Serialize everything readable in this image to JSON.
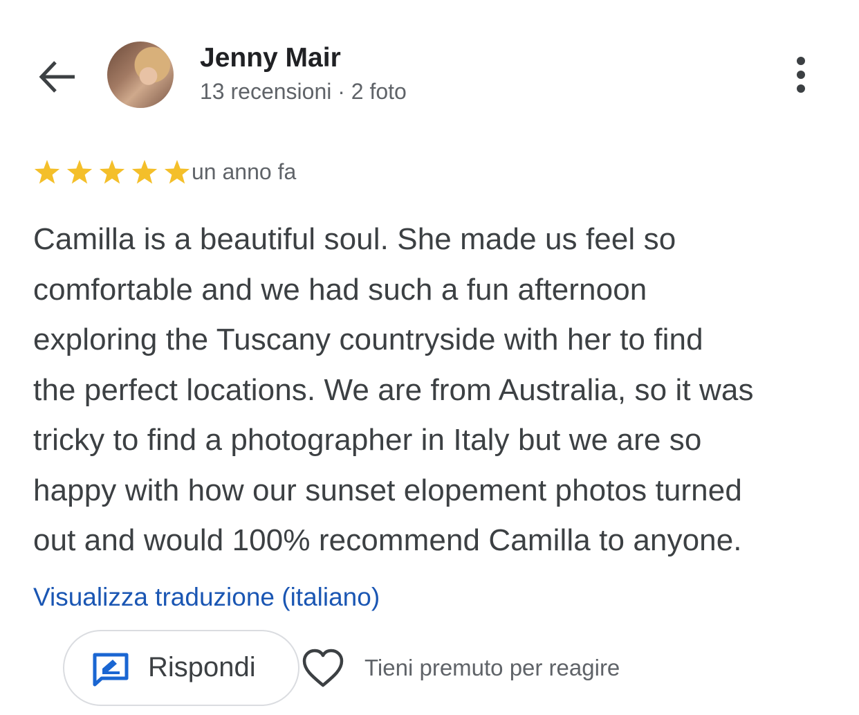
{
  "header": {
    "reviewer_name": "Jenny Mair",
    "reviewer_meta": "13 recensioni · 2 foto",
    "back_icon": "arrow-left-icon",
    "more_icon": "more-vertical-icon"
  },
  "review": {
    "rating": 5,
    "max_rating": 5,
    "star_color": "#f4bf2a",
    "time_ago": "un anno fa",
    "text": "Camilla is a beautiful soul. She made us feel so comfortable and we had such a fun afternoon exploring the Tuscany countryside with her to find the perfect locations. We are from Australia, so it was tricky to find a photographer in Italy but we are so happy with how our sunset elopement photos turned out and would 100% recommend Camilla to anyone.",
    "text_lines": [
      "Camilla is a beautiful soul. She made us feel so",
      "comfortable and we had such a fun afternoon",
      "exploring the Tuscany countryside with her to find",
      "the perfect locations. We are from Australia, so it was",
      "tricky to find a photographer in Italy but we are so",
      "happy with how our sunset elopement photos turned",
      "out and would 100% recommend Camilla to anyone."
    ],
    "translate_link": "Visualizza traduzione (italiano)",
    "link_color": "#1a56b3"
  },
  "actions": {
    "reply_label": "Rispondi",
    "reply_icon": "reply-edit-icon",
    "reply_icon_color": "#1a66d2",
    "heart_icon": "heart-outline-icon",
    "react_hint": "Tieni premuto per reagire"
  }
}
